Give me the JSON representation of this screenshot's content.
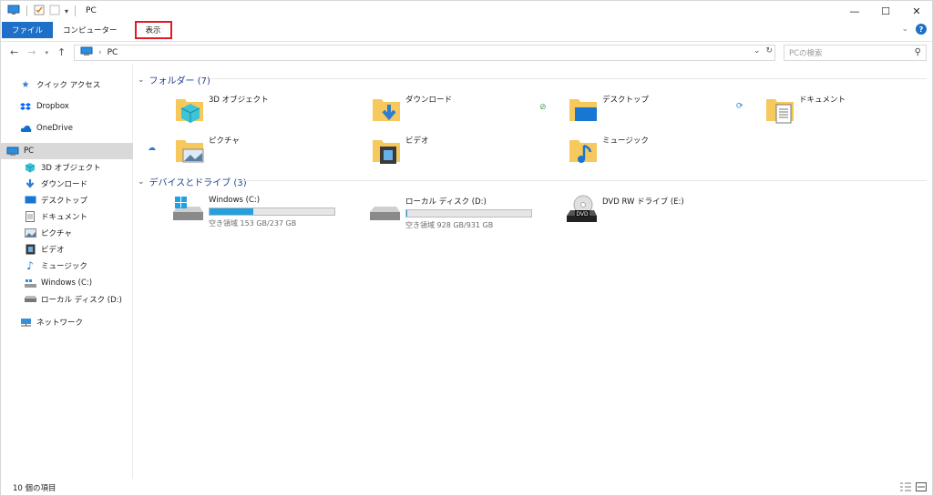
{
  "titlebar": {
    "title": "PC"
  },
  "ribbon": {
    "tabs": [
      "ファイル",
      "コンピューター",
      "表示"
    ]
  },
  "address": {
    "path": "PC",
    "search_placeholder": "PCの検索"
  },
  "sidebar": {
    "quick_access": "クイック アクセス",
    "dropbox": "Dropbox",
    "onedrive": "OneDrive",
    "pc": "PC",
    "children": [
      "3D オブジェクト",
      "ダウンロード",
      "デスクトップ",
      "ドキュメント",
      "ピクチャ",
      "ビデオ",
      "ミュージック",
      "Windows (C:)",
      "ローカル ディスク (D:)"
    ],
    "network": "ネットワーク"
  },
  "main": {
    "folders_header": "フォルダー (7)",
    "folders": [
      {
        "label": "3D オブジェクト",
        "icon": "3d-objects-icon"
      },
      {
        "label": "ダウンロード",
        "icon": "download-icon"
      },
      {
        "label": "デスクトップ",
        "icon": "desktop-icon"
      },
      {
        "label": "ドキュメント",
        "icon": "documents-icon"
      },
      {
        "label": "ピクチャ",
        "icon": "pictures-icon"
      },
      {
        "label": "ビデオ",
        "icon": "video-icon"
      },
      {
        "label": "ミュージック",
        "icon": "music-icon"
      }
    ],
    "devices_header": "デバイスとドライブ (3)",
    "drives": [
      {
        "label": "Windows (C:)",
        "free": "空き領域 153 GB/237 GB",
        "used_fraction": 0.354
      },
      {
        "label": "ローカル ディスク (D:)",
        "free": "空き領域 928 GB/931 GB",
        "used_fraction": 0.003
      },
      {
        "label": "DVD RW ドライブ (E:)"
      }
    ]
  },
  "status": {
    "items": "10 個の項目"
  },
  "colors": {
    "accent": "#1d6fc7",
    "highlight": "#e11b24",
    "bar_fill": "#26a0da",
    "folder": "#f7c85c"
  }
}
